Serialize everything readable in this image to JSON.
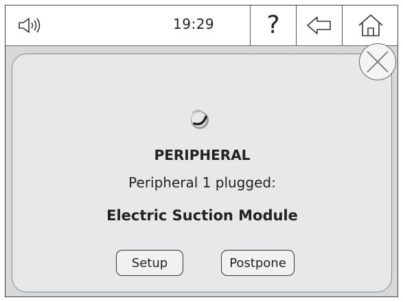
{
  "status_bar": {
    "time": "19:29",
    "sound_icon": "speaker-icon",
    "help_label": "?",
    "back_icon": "back-arrow-icon",
    "home_icon": "home-icon"
  },
  "dialog": {
    "icon": "peripheral-icon",
    "title": "PERIPHERAL",
    "message": "Peripheral 1 plugged:",
    "device_name": "Electric Suction Module",
    "setup_label": "Setup",
    "postpone_label": "Postpone",
    "close_icon": "close-icon"
  },
  "colors": {
    "panel_bg": "#e7e8e9",
    "screen_bg": "#d6d8da",
    "topbar_bg": "#ffffff",
    "text": "#222222"
  }
}
